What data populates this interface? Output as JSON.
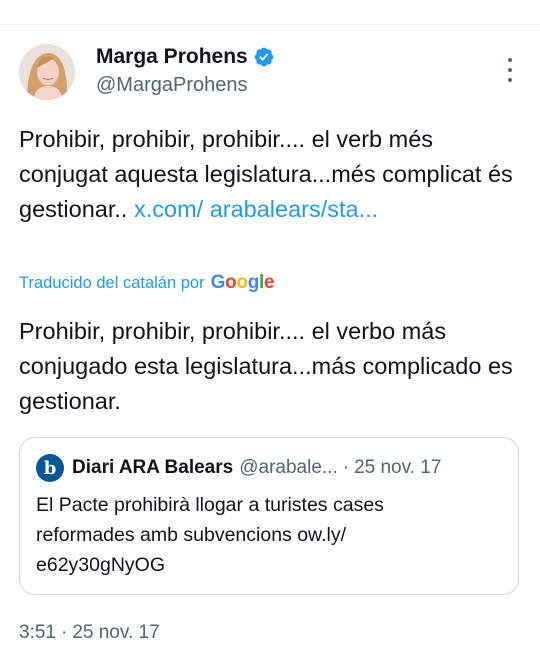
{
  "author": {
    "name": "Marga Prohens",
    "handle": "@MargaProhens",
    "verified": true,
    "avatar_icon": "profile-photo"
  },
  "tweet": {
    "text_before_link": "Prohibir, prohibir, prohibir.... el verb més conjugat aquesta legislatura...més complicat és gestionar.. ",
    "link_text": "x.com/ arabalears/sta..."
  },
  "translation": {
    "label": "Traducido del catalán por",
    "provider": "Google",
    "text": "Prohibir, prohibir, prohibir.... el verbo más conjugado esta legislatura...más complicado es gestionar."
  },
  "quoted_tweet": {
    "logo_letter": "b",
    "name": "Diari ARA Balears",
    "handle": "@arabale...",
    "separator": "·",
    "date": "25 nov. 17",
    "text": "El Pacte prohibirà llogar a turistes cases reformades amb subvencions ow.ly/ e62y30gNyOG"
  },
  "meta": {
    "time": "3:51",
    "separator": "·",
    "date": "25 nov. 17"
  },
  "colors": {
    "link": "#1d9bf0",
    "secondary_text": "#536471",
    "border": "#cfd9de",
    "quote_logo": "#0b5694"
  }
}
